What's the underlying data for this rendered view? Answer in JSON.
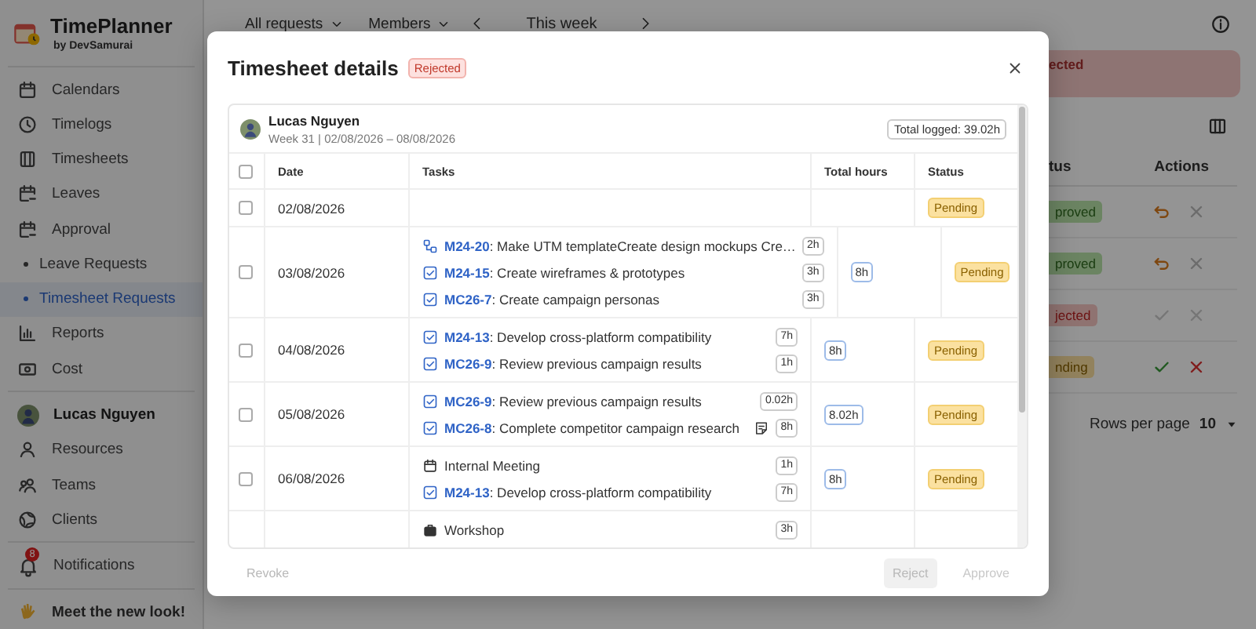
{
  "app": {
    "name": "TimePlanner",
    "byline": "by DevSamurai"
  },
  "sidebar": {
    "items": [
      {
        "label": "Calendars",
        "kind": "calendar",
        "selected": false
      },
      {
        "label": "Timelogs",
        "kind": "clock",
        "selected": false
      },
      {
        "label": "Timesheets",
        "kind": "sheet",
        "selected": false
      },
      {
        "label": "Leaves",
        "kind": "leave",
        "selected": false
      },
      {
        "label": "Approval",
        "kind": "leave",
        "selected": false,
        "expanded": true,
        "children": [
          {
            "label": "Leave Requests",
            "selected": false
          },
          {
            "label": "Timesheet Requests",
            "selected": true
          }
        ]
      },
      {
        "label": "Reports",
        "kind": "chart",
        "selected": false
      },
      {
        "label": "Cost",
        "kind": "cash",
        "selected": false
      }
    ],
    "user": {
      "name": "Lucas Nguyen"
    },
    "people_items": [
      {
        "label": "Resources",
        "kind": "person",
        "selected": false
      },
      {
        "label": "Teams",
        "kind": "team",
        "selected": false
      },
      {
        "label": "Clients",
        "kind": "globe",
        "selected": false
      }
    ],
    "notifications": {
      "label": "Notifications",
      "count": "8"
    },
    "promo": "Meet the new look!"
  },
  "toolbar": {
    "filters": [
      "All requests",
      "Members"
    ],
    "period": "This week"
  },
  "background": {
    "banner": "ected",
    "columns": [
      "tus",
      "Actions"
    ],
    "rows": [
      {
        "status": "proved",
        "kind": "approved"
      },
      {
        "status": "proved",
        "kind": "approved"
      },
      {
        "status": "jected",
        "kind": "rejected"
      },
      {
        "status": "nding",
        "kind": "pending"
      }
    ],
    "rows_per_page": {
      "label": "Rows per page",
      "value": "10"
    }
  },
  "modal": {
    "title": "Timesheet details",
    "badge": "Rejected",
    "user": {
      "name": "Lucas Nguyen",
      "week": "Week 31 | 02/08/2026 – 08/08/2026"
    },
    "total_logged": "Total logged: 39.02h",
    "columns": [
      "Date",
      "Tasks",
      "Total hours",
      "Status"
    ],
    "header_checked": false,
    "rows": [
      {
        "date": "02/08/2026",
        "checked": false,
        "status": "Pending",
        "tasks": []
      },
      {
        "date": "03/08/2026",
        "checked": false,
        "total": "8h",
        "status": "Pending",
        "tasks": [
          {
            "kind": "subtask",
            "code": "M24-20",
            "title": ": Make UTM templateCreate design mockups Cre…",
            "hours": "2h"
          },
          {
            "kind": "task",
            "code": "M24-15",
            "title": ": Create wireframes & prototypes",
            "hours": "3h"
          },
          {
            "kind": "task",
            "code": "MC26-7",
            "title": ": Create campaign personas",
            "hours": "3h"
          }
        ]
      },
      {
        "date": "04/08/2026",
        "checked": false,
        "total": "8h",
        "status": "Pending",
        "tasks": [
          {
            "kind": "task",
            "code": "M24-13",
            "title": ": Develop cross-platform compatibility",
            "hours": "7h"
          },
          {
            "kind": "task",
            "code": "MC26-9",
            "title": ": Review previous campaign results",
            "hours": "1h"
          }
        ]
      },
      {
        "date": "05/08/2026",
        "checked": false,
        "total": "8.02h",
        "status": "Pending",
        "tasks": [
          {
            "kind": "task",
            "code": "MC26-9",
            "title": ": Review previous campaign results",
            "hours": "0.02h"
          },
          {
            "kind": "task",
            "code": "MC26-8",
            "title": ": Complete competitor campaign research",
            "hours": "8h",
            "note": true
          }
        ]
      },
      {
        "date": "06/08/2026",
        "checked": false,
        "total": "8h",
        "status": "Pending",
        "tasks": [
          {
            "kind": "meeting",
            "title": "Internal Meeting",
            "hours": "1h"
          },
          {
            "kind": "task",
            "code": "M24-13",
            "title": ": Develop cross-platform compatibility",
            "hours": "7h"
          }
        ]
      },
      {
        "tasks": [
          {
            "kind": "workshop",
            "title": "Workshop",
            "hours": "3h"
          }
        ]
      }
    ],
    "buttons": [
      {
        "label": "Revoke",
        "kind": "text",
        "disabled": true
      },
      {
        "label": "Reject",
        "kind": "secondary",
        "disabled": true
      },
      {
        "label": "Approve",
        "kind": "primary",
        "disabled": true
      }
    ]
  }
}
